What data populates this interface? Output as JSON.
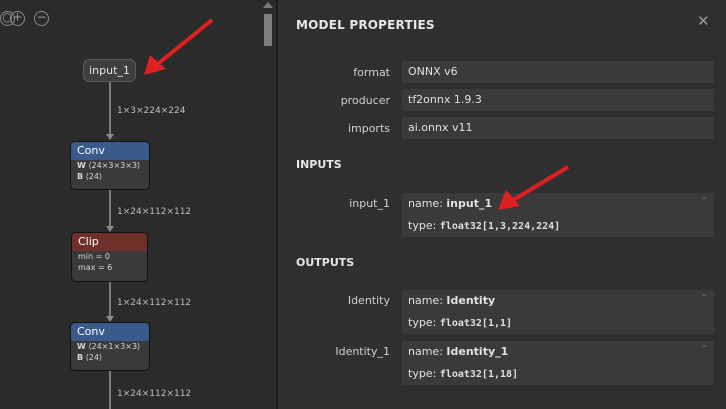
{
  "graph": {
    "toolbar": [
      "fit-icon",
      "zoom-in-icon",
      "zoom-out-icon"
    ],
    "input_node": "input_1",
    "edges": [
      "1×3×224×224",
      "1×24×112×112",
      "1×24×112×112",
      "1×24×112×112"
    ],
    "nodes": [
      {
        "title": "Conv",
        "type": "conv",
        "attrs": [
          {
            "k": "W",
            "v": "⟨24×3×3×3⟩"
          },
          {
            "k": "B",
            "v": "⟨24⟩"
          }
        ]
      },
      {
        "title": "Clip",
        "type": "clip",
        "attrs": [
          {
            "k": "",
            "v": "min = 0"
          },
          {
            "k": "",
            "v": "max = 6"
          }
        ]
      },
      {
        "title": "Conv",
        "type": "conv",
        "attrs": [
          {
            "k": "W",
            "v": "⟨24×1×3×3⟩"
          },
          {
            "k": "B",
            "v": "⟨24⟩"
          }
        ]
      }
    ],
    "arrow_color": "#e02020"
  },
  "props": {
    "title": "MODEL PROPERTIES",
    "close": "✕",
    "model": [
      {
        "label": "format",
        "value": "ONNX v6"
      },
      {
        "label": "producer",
        "value": "tf2onnx 1.9.3"
      },
      {
        "label": "imports",
        "value": "ai.onnx v11"
      }
    ],
    "inputs_title": "INPUTS",
    "inputs": [
      {
        "label": "input_1",
        "name_prefix": "name: ",
        "name": "input_1",
        "type_prefix": "type: ",
        "type": "float32[1,3,224,224]",
        "dash": "-"
      }
    ],
    "outputs_title": "OUTPUTS",
    "outputs": [
      {
        "label": "Identity",
        "name_prefix": "name: ",
        "name": "Identity",
        "type_prefix": "type: ",
        "type": "float32[1,1]",
        "dash": "-"
      },
      {
        "label": "Identity_1",
        "name_prefix": "name: ",
        "name": "Identity_1",
        "type_prefix": "type: ",
        "type": "float32[1,18]",
        "dash": "-"
      }
    ]
  }
}
